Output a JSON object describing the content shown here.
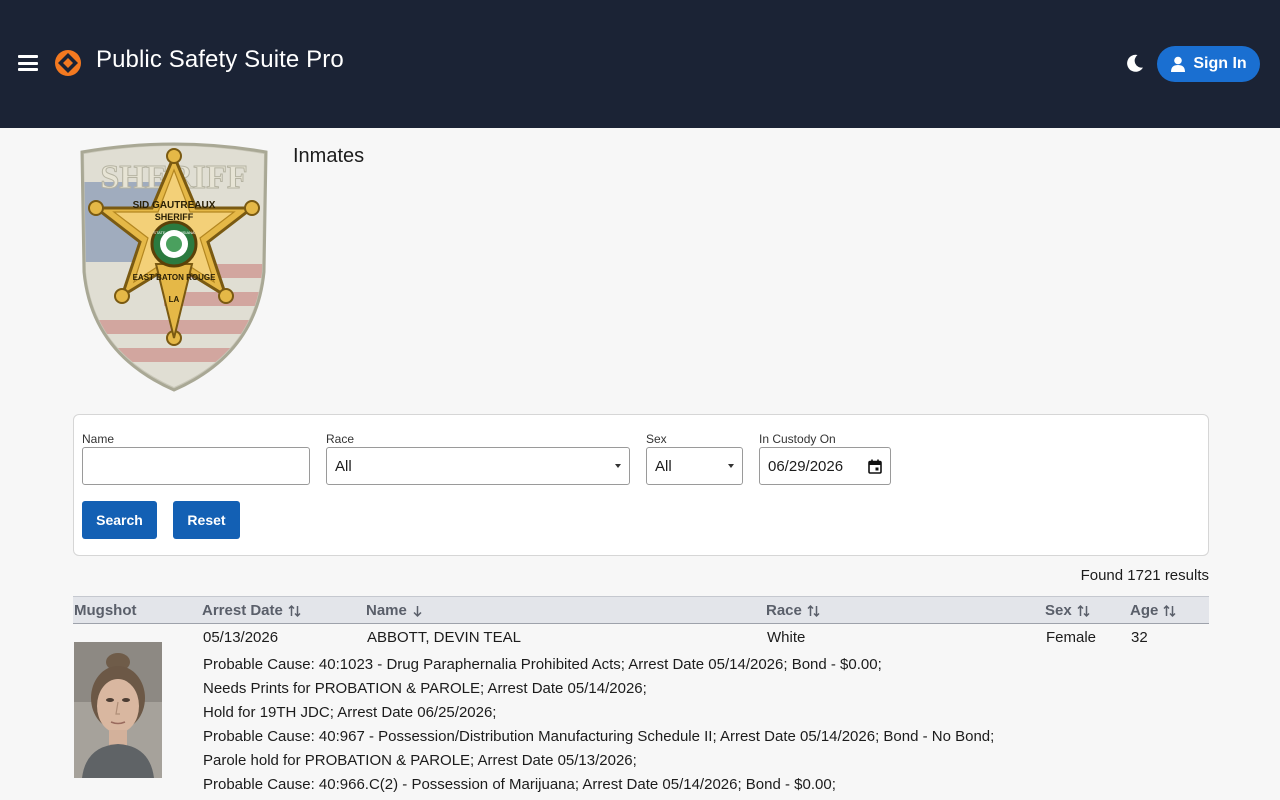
{
  "app": {
    "title": "Public Safety Suite Pro"
  },
  "header": {
    "signin_label": "Sign In"
  },
  "page": {
    "heading": "Inmates"
  },
  "filters": {
    "name_label": "Name",
    "name_value": "",
    "race_label": "Race",
    "race_value": "All",
    "sex_label": "Sex",
    "sex_value": "All",
    "custody_label": "In Custody On",
    "custody_value": "06/29/2026",
    "search_label": "Search",
    "reset_label": "Reset"
  },
  "results": {
    "count_text": "Found 1721 results"
  },
  "table": {
    "columns": [
      "Mugshot",
      "Arrest Date",
      "Name",
      "Race",
      "Sex",
      "Age"
    ],
    "rows": [
      {
        "arrest_date": "05/13/2026",
        "name": "ABBOTT, DEVIN TEAL",
        "race": "White",
        "sex": "Female",
        "age": "32",
        "charges": [
          "Probable Cause: 40:1023 - Drug Paraphernalia Prohibited Acts; Arrest Date 05/14/2026; Bond - $0.00;",
          "Needs Prints for PROBATION & PAROLE; Arrest Date 05/14/2026;",
          "Hold for 19TH JDC; Arrest Date 06/25/2026;",
          "Probable Cause: 40:967 - Possession/Distribution Manufacturing Schedule II; Arrest Date 05/14/2026; Bond - No Bond;",
          "Parole hold for PROBATION & PAROLE; Arrest Date 05/13/2026;",
          "Probable Cause: 40:966.C(2) - Possession of Marijuana; Arrest Date 05/14/2026; Bond - $0.00;"
        ]
      }
    ]
  },
  "colors": {
    "header_bg": "#1b2335",
    "primary": "#1a6fd1",
    "button": "#1360b4",
    "logo": "#f47920"
  },
  "icons": [
    "hamburger-menu-icon",
    "app-logo-icon",
    "moon-icon",
    "user-icon",
    "calendar-icon",
    "sort-icon",
    "sort-desc-icon"
  ],
  "badge_text": {
    "top": "SHERIFF",
    "name": "SID GAUTREAUX",
    "role": "SHERIFF",
    "seal": "STATE OF LOUISIANA",
    "parish": "EAST BATON ROUGE",
    "state": "LA"
  }
}
